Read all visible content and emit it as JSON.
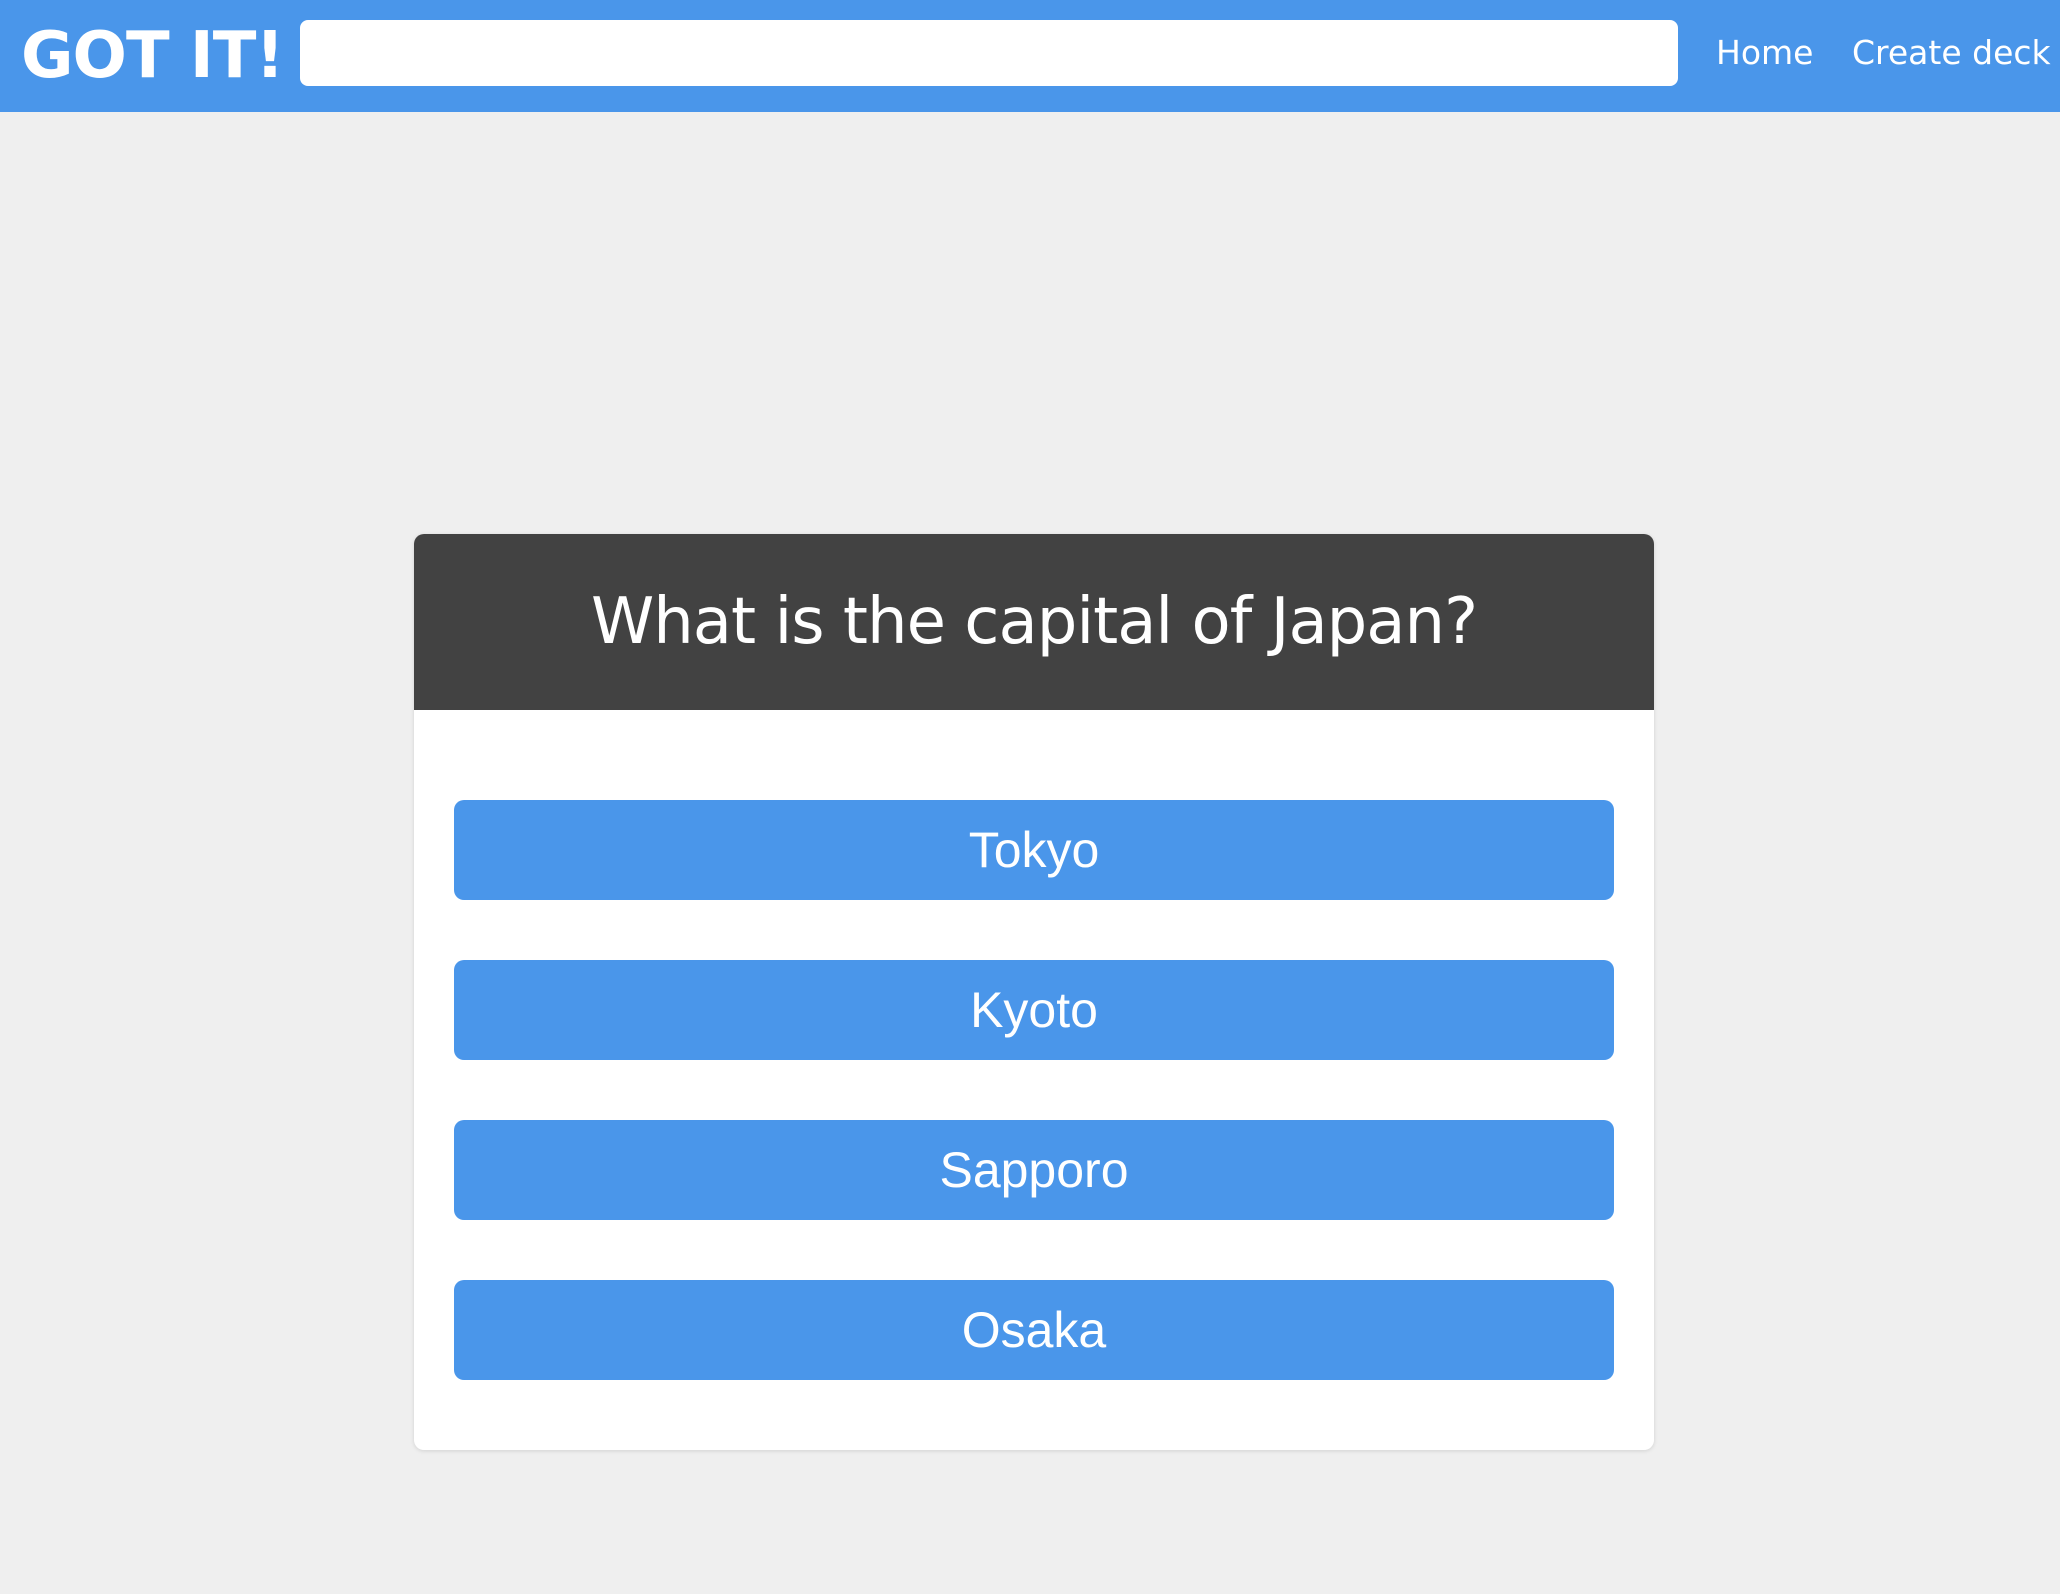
{
  "navbar": {
    "logo": "GOT IT!",
    "search": {
      "value": "",
      "placeholder": ""
    },
    "links": {
      "home": "Home",
      "create_deck": "Create deck"
    }
  },
  "card": {
    "question": "What is the capital of Japan?",
    "answers": [
      "Tokyo",
      "Kyoto",
      "Sapporo",
      "Osaka"
    ]
  },
  "colors": {
    "accent": "#4a96ea",
    "card_header": "#424242",
    "background": "#efefef"
  }
}
